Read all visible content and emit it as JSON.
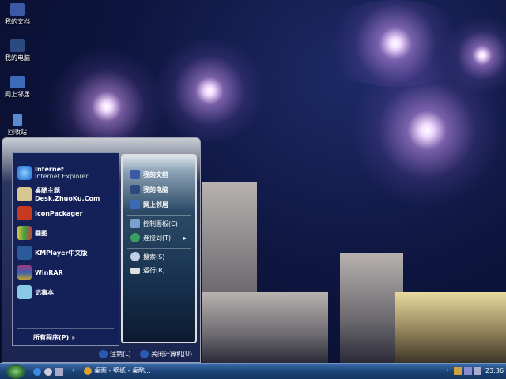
{
  "desktop_icons": [
    {
      "label": "我的文档",
      "icon": "documents-folder-icon"
    },
    {
      "label": "我的电脑",
      "icon": "computer-icon"
    },
    {
      "label": "网上邻居",
      "icon": "network-icon"
    },
    {
      "label": "回收站",
      "icon": "recycle-bin-icon"
    }
  ],
  "start_menu": {
    "pinned": [
      {
        "title": "Internet",
        "subtitle": "Internet Explorer",
        "icon": "ie-icon"
      },
      {
        "title": "桌酷主题Desk.ZhuoKu.Com",
        "icon": "zhuoku-icon"
      },
      {
        "title": "IconPackager",
        "icon": "iconpackager-icon"
      },
      {
        "title": "画图",
        "icon": "paint-icon"
      },
      {
        "title": "KMPlayer中文版",
        "icon": "kmplayer-icon"
      },
      {
        "title": "WinRAR",
        "icon": "winrar-icon"
      },
      {
        "title": "记事本",
        "icon": "notepad-icon"
      }
    ],
    "all_programs": "所有程序(P)",
    "right_items": [
      {
        "label": "我的文档",
        "color": "#3a5aa8"
      },
      {
        "label": "我的电脑",
        "color": "#4a6ab0"
      },
      {
        "label": "网上邻居",
        "color": "#3a6ab8"
      },
      {
        "label": "控制面板(C)",
        "color": "#7aa0d0"
      },
      {
        "label": "连接到(T)",
        "color": "#3aa060"
      },
      {
        "label": "搜索(S)",
        "color": "#c0d0e8"
      },
      {
        "label": "运行(R)...",
        "color": "#e0e0e0"
      }
    ],
    "logoff": "注销(L)",
    "shutdown": "关闭计算机(U)"
  },
  "taskbar": {
    "window_title": "桌面 - 壁纸 - 桌酷...",
    "clock": "23:36"
  }
}
